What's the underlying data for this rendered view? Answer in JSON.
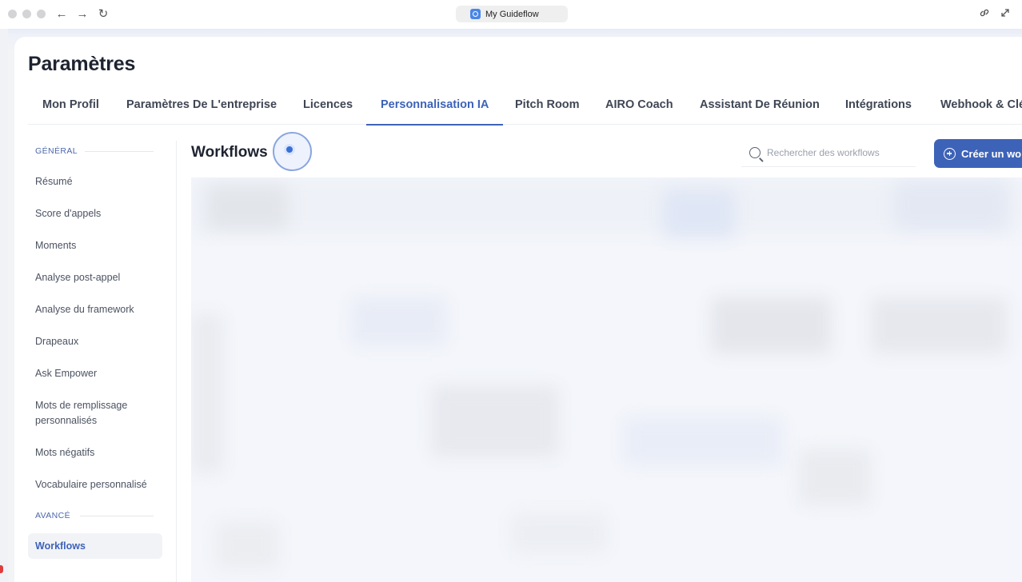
{
  "browser": {
    "tab_title": "My Guideflow",
    "back_icon": "←",
    "forward_icon": "→",
    "reload_icon": "↻",
    "link_icon": "🔗",
    "expand_icon": "⤢"
  },
  "page": {
    "title": "Paramètres"
  },
  "tabs": [
    {
      "label": "Mon Profil"
    },
    {
      "label": "Paramètres De L'entreprise"
    },
    {
      "label": "Licences"
    },
    {
      "label": "Personnalisation IA",
      "active": true
    },
    {
      "label": "Pitch Room"
    },
    {
      "label": "AIRO Coach"
    },
    {
      "label": "Assistant De Réunion"
    },
    {
      "label": "Intégrations"
    },
    {
      "label": "Webhook & Clé"
    }
  ],
  "sidebar": {
    "general_label": "GÉNÉRAL",
    "advanced_label": "AVANCÉ",
    "items": [
      {
        "label": "Résumé"
      },
      {
        "label": "Score d'appels"
      },
      {
        "label": "Moments"
      },
      {
        "label": "Analyse post-appel"
      },
      {
        "label": "Analyse du framework"
      },
      {
        "label": "Drapeaux"
      },
      {
        "label": "Ask Empower"
      },
      {
        "label": "Mots de remplissage personnalisés"
      },
      {
        "label": "Mots négatifs"
      },
      {
        "label": "Vocabulaire personnalisé"
      }
    ],
    "advanced_items": [
      {
        "label": "Workflows",
        "active": true
      }
    ]
  },
  "content": {
    "title": "Workflows",
    "search_placeholder": "Rechercher des workflows",
    "create_button_label": "Créer un workflow"
  },
  "colors": {
    "accent": "#3d63b8",
    "text": "#1e2330"
  }
}
